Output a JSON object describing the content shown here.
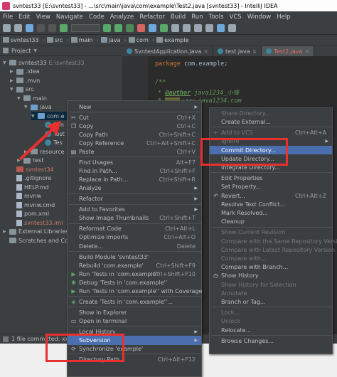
{
  "window": {
    "title": "svntest33 [E:\\svntest33] - ...\\src\\main\\java\\com\\example\\Test2.java [svntest33] - IntelliJ IDEA"
  },
  "menubar": [
    "File",
    "Edit",
    "View",
    "Navigate",
    "Code",
    "Analyze",
    "Refactor",
    "Build",
    "Run",
    "Tools",
    "VCS",
    "Window",
    "Help"
  ],
  "breadcrumbs": [
    "svntest33",
    "src",
    "main",
    "java",
    "com",
    "example"
  ],
  "project_panel": {
    "header": "Project",
    "tree": [
      {
        "label": "svntest33",
        "suffix": "E:\\svntest33",
        "indent": 0,
        "icon": "folder-icon",
        "arrow": "▼"
      },
      {
        "label": ".idea",
        "indent": 1,
        "icon": "folder-icon",
        "arrow": "▶"
      },
      {
        "label": ".mvn",
        "indent": 1,
        "icon": "folder-icon",
        "arrow": "▶"
      },
      {
        "label": "src",
        "indent": 1,
        "icon": "folder-icon",
        "arrow": "▼"
      },
      {
        "label": "main",
        "indent": 2,
        "icon": "folder-icon",
        "arrow": "▼"
      },
      {
        "label": "java",
        "indent": 3,
        "icon": "folder-blue-icon",
        "arrow": "▼"
      },
      {
        "label": "com.e",
        "indent": 4,
        "icon": "package-icon",
        "arrow": "▼",
        "selected": true
      },
      {
        "label": "Svn",
        "indent": 5,
        "icon": "class-icon",
        "arrow": ""
      },
      {
        "label": "Test",
        "indent": 5,
        "icon": "class-icon",
        "arrow": ""
      },
      {
        "label": "Tes",
        "indent": 5,
        "icon": "class-icon",
        "arrow": ""
      },
      {
        "label": "resource",
        "indent": 3,
        "icon": "folder-icon",
        "arrow": "▶"
      },
      {
        "label": "test",
        "indent": 2,
        "icon": "folder-icon",
        "arrow": "▶"
      },
      {
        "label": "svntest34",
        "indent": 1,
        "icon": "folder-red-icon",
        "arrow": ""
      },
      {
        "label": ".gitignore",
        "indent": 1,
        "icon": "file-icon",
        "arrow": ""
      },
      {
        "label": "HELP.md",
        "indent": 1,
        "icon": "file-icon",
        "arrow": ""
      },
      {
        "label": "mvnw",
        "indent": 1,
        "icon": "file-icon",
        "arrow": ""
      },
      {
        "label": "mvnw.cmd",
        "indent": 1,
        "icon": "file-icon",
        "arrow": ""
      },
      {
        "label": "pom.xml",
        "indent": 1,
        "icon": "file-icon",
        "arrow": ""
      },
      {
        "label": "svntest33.iml",
        "indent": 1,
        "icon": "file-icon",
        "arrow": ""
      },
      {
        "label": "External Libraries",
        "indent": 0,
        "icon": "library-icon",
        "arrow": "▶"
      },
      {
        "label": "Scratches and Conso",
        "indent": 0,
        "icon": "scratch-icon",
        "arrow": ""
      }
    ]
  },
  "tabs": [
    {
      "label": "SvntestApplication.java",
      "active": false
    },
    {
      "label": "test.java",
      "active": false
    },
    {
      "label": "Test2.java",
      "active": true
    }
  ],
  "code": {
    "package_kw": "package",
    "package_name": " com.example;",
    "line2": "/**",
    "author_tag": "@author",
    "author_val": " java1234_小锋",
    "site_val": "www.java1234.com",
    "line5": " * ..."
  },
  "status_bar": "1 file committed: xxx",
  "context_menu": [
    {
      "label": "New",
      "shortcut": "",
      "submenu": true,
      "icon": ""
    },
    {
      "sep": true
    },
    {
      "label": "Cut",
      "shortcut": "Ctrl+X",
      "icon": "cut-icon",
      "glyph": "✂",
      "underline": "t"
    },
    {
      "label": "Copy",
      "shortcut": "Ctrl+C",
      "icon": "copy-icon",
      "glyph": "❐"
    },
    {
      "label": "Copy Path",
      "shortcut": "Ctrl+Shift+C",
      "icon": ""
    },
    {
      "label": "Copy Reference",
      "shortcut": "Ctrl+Alt+Shift+C",
      "icon": ""
    },
    {
      "label": "Paste",
      "shortcut": "Ctrl+V",
      "icon": "paste-icon",
      "glyph": "▤"
    },
    {
      "sep": true
    },
    {
      "label": "Find Usages",
      "shortcut": "Alt+F7",
      "icon": ""
    },
    {
      "label": "Find in Path...",
      "shortcut": "Ctrl+Shift+F",
      "icon": ""
    },
    {
      "label": "Replace in Path...",
      "shortcut": "Ctrl+Shift+R",
      "icon": ""
    },
    {
      "label": "Analyze",
      "shortcut": "",
      "submenu": true,
      "icon": ""
    },
    {
      "sep": true
    },
    {
      "label": "Refactor",
      "shortcut": "",
      "submenu": true,
      "icon": ""
    },
    {
      "sep": true
    },
    {
      "label": "Add to Favorites",
      "shortcut": "",
      "submenu": true,
      "icon": ""
    },
    {
      "label": "Show Image Thumbnails",
      "shortcut": "Ctrl+Shift+T",
      "icon": ""
    },
    {
      "sep": true
    },
    {
      "label": "Reformat Code",
      "shortcut": "Ctrl+Alt+L",
      "icon": ""
    },
    {
      "label": "Optimize Imports",
      "shortcut": "Ctrl+Alt+O",
      "icon": ""
    },
    {
      "label": "Delete...",
      "shortcut": "Delete",
      "icon": ""
    },
    {
      "sep": true
    },
    {
      "label": "Build Module 'svntest33'",
      "shortcut": "",
      "icon": ""
    },
    {
      "label": "Rebuild 'com.example'",
      "shortcut": "Ctrl+Shift+F9",
      "icon": ""
    },
    {
      "label": "Run 'Tests in 'com.example''",
      "shortcut": "Ctrl+Shift+F10",
      "icon": "run-icon",
      "glyph": "▶",
      "color": "#59a869"
    },
    {
      "label": "Debug 'Tests in 'com.example''",
      "shortcut": "",
      "icon": "debug-icon",
      "glyph": "✱",
      "color": "#59a869"
    },
    {
      "label": "Run 'Tests in 'com.example'' with Coverage",
      "shortcut": "",
      "icon": "coverage-icon",
      "glyph": "▶",
      "color": "#59a869"
    },
    {
      "sep": true
    },
    {
      "label": "Create 'Tests in 'com.example''...",
      "shortcut": "",
      "icon": "create-test-icon",
      "glyph": "◈",
      "color": "#59a869"
    },
    {
      "sep": true
    },
    {
      "label": "Show in Explorer",
      "shortcut": "",
      "icon": ""
    },
    {
      "label": "Open in terminal",
      "shortcut": "",
      "icon": "terminal-icon",
      "glyph": "▭"
    },
    {
      "sep": true
    },
    {
      "label": "Local History",
      "shortcut": "",
      "submenu": true,
      "icon": ""
    },
    {
      "label": "Subversion",
      "shortcut": "",
      "submenu": true,
      "icon": "",
      "selected": true
    },
    {
      "label": "Synchronize 'example'",
      "shortcut": "",
      "icon": "sync-icon",
      "glyph": "⟳"
    },
    {
      "sep": true
    },
    {
      "label": "Directory Path",
      "shortcut": "Ctrl+Alt+F12",
      "icon": ""
    }
  ],
  "svn_menu": [
    {
      "label": "Share Directory...",
      "shortcut": "",
      "disabled": true
    },
    {
      "label": "Create External...",
      "shortcut": ""
    },
    {
      "sep": true
    },
    {
      "label": "Add to VCS",
      "shortcut": "Ctrl+Alt+A",
      "disabled": true,
      "icon": "add-icon",
      "glyph": "+"
    },
    {
      "label": "Ignore",
      "shortcut": "",
      "submenu": true,
      "disabled": true
    },
    {
      "label": "Commit Directory...",
      "shortcut": "",
      "selected": true
    },
    {
      "label": "Update Directory...",
      "shortcut": ""
    },
    {
      "label": "Integrate Directory...",
      "shortcut": ""
    },
    {
      "sep": true
    },
    {
      "label": "Edit Properties",
      "shortcut": ""
    },
    {
      "label": "Set Property...",
      "shortcut": ""
    },
    {
      "label": "Revert...",
      "shortcut": "Ctrl+Alt+Z",
      "icon": "revert-icon",
      "glyph": "↶"
    },
    {
      "label": "Resolve Text Conflict...",
      "shortcut": ""
    },
    {
      "label": "Mark Resolved...",
      "shortcut": ""
    },
    {
      "label": "Cleanup",
      "shortcut": ""
    },
    {
      "sep": true
    },
    {
      "label": "Show Current Revision",
      "shortcut": "",
      "disabled": true
    },
    {
      "label": "Compare with the Same Repository Version",
      "shortcut": "",
      "disabled": true
    },
    {
      "label": "Compare with Latest Repository Version",
      "shortcut": "",
      "disabled": true
    },
    {
      "label": "Compare with...",
      "shortcut": "",
      "disabled": true
    },
    {
      "label": "Compare with Branch...",
      "shortcut": ""
    },
    {
      "label": "Show History",
      "shortcut": "",
      "icon": "history-icon",
      "glyph": "◷"
    },
    {
      "label": "Show History for Selection",
      "shortcut": "",
      "disabled": true
    },
    {
      "label": "Annotate",
      "shortcut": "",
      "disabled": true
    },
    {
      "label": "Branch or Tag...",
      "shortcut": ""
    },
    {
      "sep": true
    },
    {
      "label": "Lock...",
      "shortcut": "",
      "disabled": true
    },
    {
      "label": "Unlock",
      "shortcut": "",
      "disabled": true
    },
    {
      "label": "Relocate...",
      "shortcut": ""
    },
    {
      "sep": true
    },
    {
      "label": "Browse Changes...",
      "shortcut": ""
    }
  ],
  "colors": {
    "selection": "#4b6eaf",
    "highlight_box": "#e8302f",
    "menu_bg": "#3c3f41",
    "editor_bg": "#2b2b2b"
  }
}
